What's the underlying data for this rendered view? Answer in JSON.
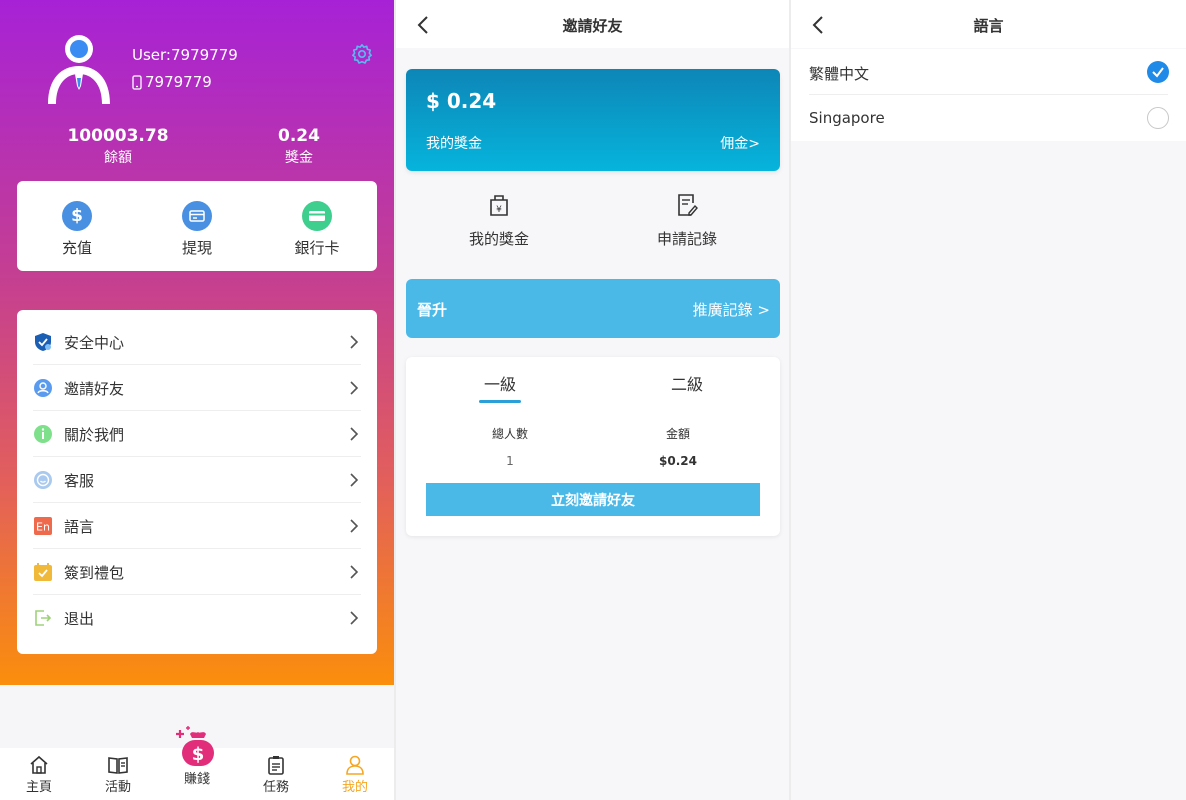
{
  "profile": {
    "username": "User:7979779",
    "phone": "7979779",
    "balance_value": "100003.78",
    "balance_label": "餘額",
    "bonus_value": "0.24",
    "bonus_label": "獎金"
  },
  "quick_actions": [
    {
      "label": "充值",
      "icon": "dollar-icon",
      "color": "#4a90e2"
    },
    {
      "label": "提現",
      "icon": "withdraw-card-icon",
      "color": "#4a90e2"
    },
    {
      "label": "銀行卡",
      "icon": "bank-card-icon",
      "color": "#3ecf8e"
    }
  ],
  "menu": [
    {
      "label": "安全中心",
      "icon": "shield-icon"
    },
    {
      "label": "邀請好友",
      "icon": "invite-user-icon"
    },
    {
      "label": "關於我們",
      "icon": "info-icon"
    },
    {
      "label": "客服",
      "icon": "customer-service-icon"
    },
    {
      "label": "語言",
      "icon": "language-en-icon"
    },
    {
      "label": "簽到禮包",
      "icon": "calendar-check-icon"
    },
    {
      "label": "退出",
      "icon": "logout-icon"
    }
  ],
  "tabbar": [
    {
      "label": "主頁",
      "icon": "home-icon",
      "active": false
    },
    {
      "label": "活動",
      "icon": "activity-book-icon",
      "active": false
    },
    {
      "label": "賺錢",
      "icon": "money-bag-icon",
      "active": false
    },
    {
      "label": "任務",
      "icon": "task-clipboard-icon",
      "active": false
    },
    {
      "label": "我的",
      "icon": "user-icon",
      "active": true
    }
  ],
  "invite": {
    "title": "邀請好友",
    "bonus_amount": "$ 0.24",
    "bonus_label": "我的獎金",
    "commission_link": "佣金>",
    "icon_actions": [
      {
        "label": "我的獎金",
        "icon": "bonus-bag-icon"
      },
      {
        "label": "申請記錄",
        "icon": "record-edit-icon"
      }
    ],
    "promo_label": "晉升",
    "promo_link": "推廣記錄 >",
    "levels": [
      "一級",
      "二級"
    ],
    "total_people_label": "總人數",
    "total_people_value": "1",
    "amount_label": "金額",
    "amount_value": "$0.24",
    "invite_button": "立刻邀請好友"
  },
  "language": {
    "title": "語言",
    "options": [
      {
        "label": "繁體中文",
        "selected": true
      },
      {
        "label": "Singapore",
        "selected": false
      }
    ]
  },
  "colors": {
    "accent_blue": "#4bb9e8",
    "tab_active": "#f5a623",
    "radio_selected": "#1f8ae8"
  }
}
